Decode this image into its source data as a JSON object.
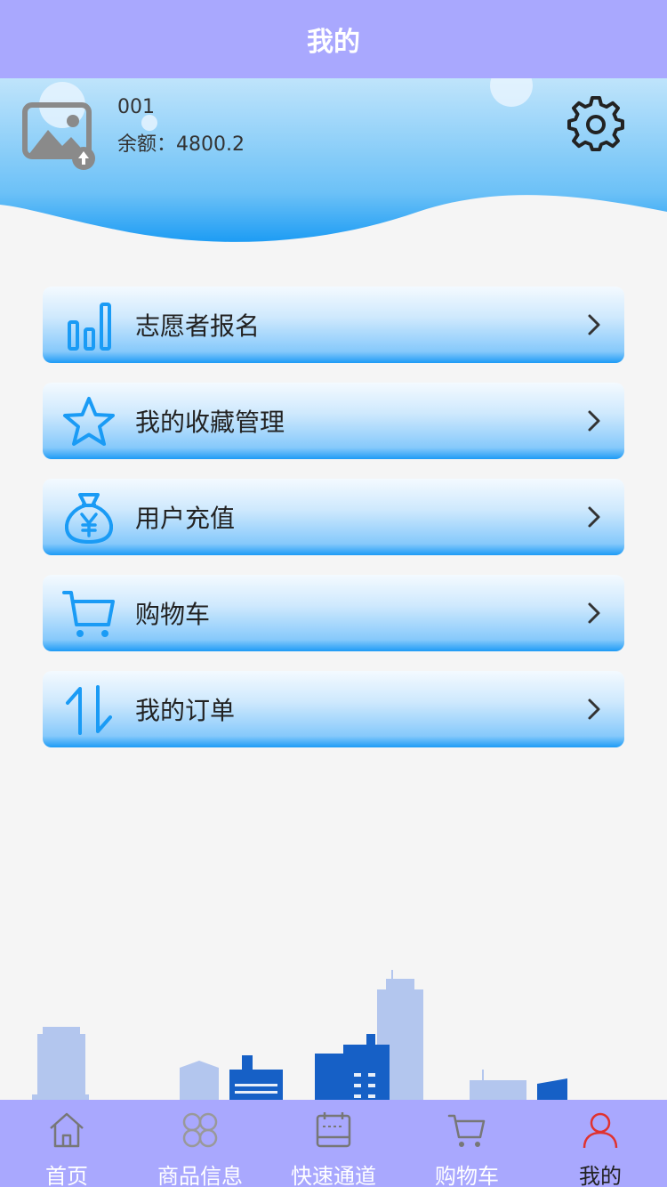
{
  "header": {
    "title": "我的"
  },
  "profile": {
    "user_id": "001",
    "balance_text": "余额：4800.2"
  },
  "menu": [
    {
      "label": "志愿者报名",
      "icon": "bar-chart-icon"
    },
    {
      "label": "我的收藏管理",
      "icon": "star-icon"
    },
    {
      "label": "用户充值",
      "icon": "money-bag-icon"
    },
    {
      "label": "购物车",
      "icon": "cart-icon"
    },
    {
      "label": "我的订单",
      "icon": "sort-arrows-icon"
    }
  ],
  "tabs": [
    {
      "label": "首页",
      "icon": "home-icon"
    },
    {
      "label": "商品信息",
      "icon": "grid-icon"
    },
    {
      "label": "快速通道",
      "icon": "calendar-icon"
    },
    {
      "label": "购物车",
      "icon": "cart-icon"
    },
    {
      "label": "我的",
      "icon": "user-icon",
      "active": true
    }
  ],
  "colors": {
    "bar": "#a9a8fe",
    "accent": "#1a9bf5",
    "active_icon": "#e0322f"
  }
}
